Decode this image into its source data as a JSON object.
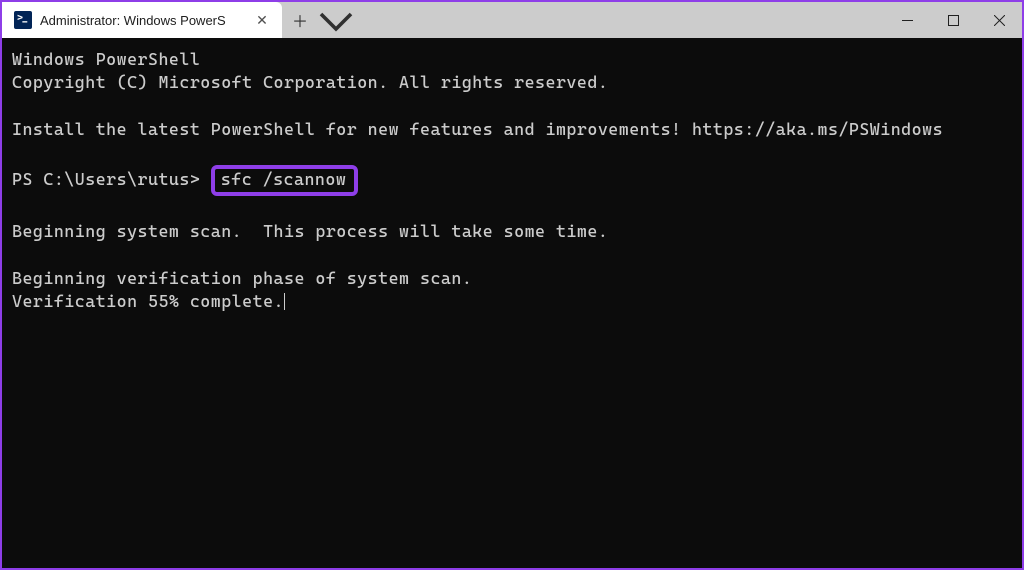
{
  "titlebar": {
    "tab": {
      "title": "Administrator: Windows PowerS"
    }
  },
  "terminal": {
    "line1": "Windows PowerShell",
    "line2": "Copyright (C) Microsoft Corporation. All rights reserved.",
    "line3": "Install the latest PowerShell for new features and improvements! https://aka.ms/PSWindows",
    "prompt": "PS C:\\Users\\rutus> ",
    "command": "sfc /scannow",
    "line5": "Beginning system scan.  This process will take some time.",
    "line6": "Beginning verification phase of system scan.",
    "line7": "Verification 55% complete."
  },
  "colors": {
    "accent": "#8e3ee8",
    "terminal_bg": "#0c0c0c",
    "terminal_fg": "#cccccc"
  }
}
